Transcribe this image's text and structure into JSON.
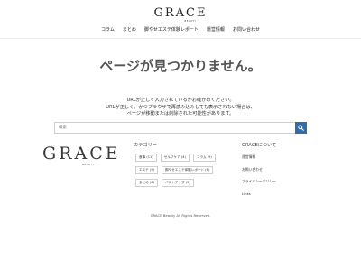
{
  "header": {
    "logo_main": "GRACE",
    "logo_sub": "BEAUTY",
    "nav": [
      "コラム",
      "まとめ",
      "脚やせエステ体験レポート",
      "運営情報",
      "お問い合わせ"
    ]
  },
  "main": {
    "heading": "ページが見つかりません。",
    "message_lines": [
      "URLが正しく入力されているかお確かめください。",
      "URLが正しく、かつブラウザで再読み込みしても表示されない場合は、",
      "ページが移動または削除された可能性があります。"
    ],
    "search": {
      "placeholder": "検索",
      "icon": "search-icon"
    },
    "colors": {
      "search_button": "#2f6dab"
    }
  },
  "footer": {
    "logo_main": "GRACE",
    "logo_sub": "BEAUTY",
    "categories_title": "カテゴリー",
    "categories": [
      "食事 (11)",
      "セルフケア (4)",
      "コラム (9)",
      "エステ (9)",
      "脚やせエステ体験レポート (6)",
      "まとめ (8)",
      "バストアップ (5)"
    ],
    "about_title": "GRACEについて",
    "about_links": [
      "運営情報",
      "お問い合わせ",
      "プライバシーポリシー",
      "Links"
    ],
    "copyright": "GRACE Beauty All Rights Reserved."
  }
}
